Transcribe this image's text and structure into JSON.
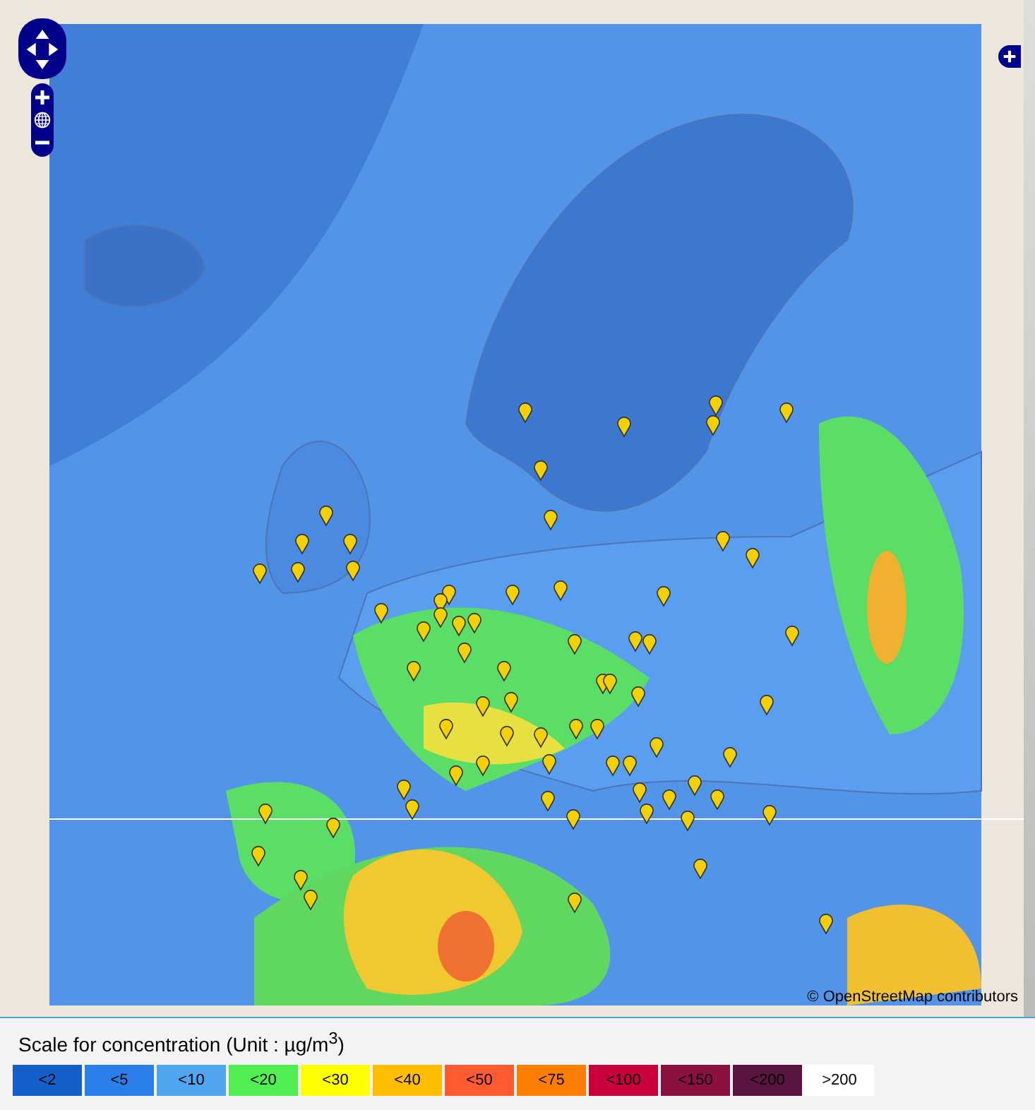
{
  "map": {
    "attribution": "© OpenStreetMap contributors"
  },
  "legend": {
    "title": "Scale for concentration (Unit :  µg/m$^{3}$)",
    "items": [
      {
        "label": "<2",
        "color": "#1560c8"
      },
      {
        "label": "<5",
        "color": "#2a80e8"
      },
      {
        "label": "<10",
        "color": "#50a4f0"
      },
      {
        "label": "<20",
        "color": "#50ee50"
      },
      {
        "label": "<30",
        "color": "#ffff00"
      },
      {
        "label": "<40",
        "color": "#ffbe00"
      },
      {
        "label": "<50",
        "color": "#ff5a32"
      },
      {
        "label": "<75",
        "color": "#ff7d00"
      },
      {
        "label": "<100",
        "color": "#c8003c"
      },
      {
        "label": "<150",
        "color": "#8c1040"
      },
      {
        "label": "<200",
        "color": "#5a1440"
      },
      {
        "label": ">200",
        "color": "#ffffff"
      }
    ]
  }
}
